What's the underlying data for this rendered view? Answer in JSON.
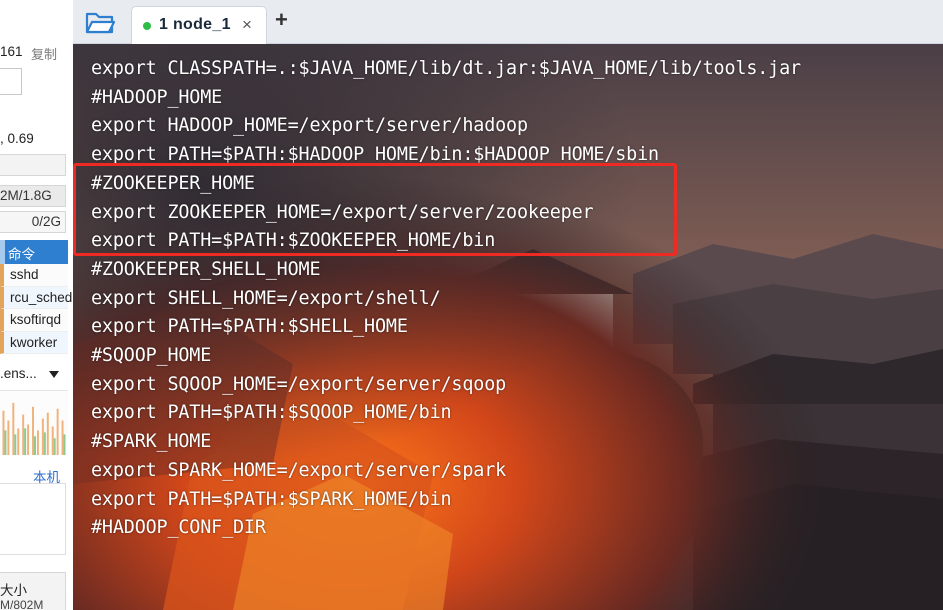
{
  "colors": {
    "tab_active_dot": "#2fbd47",
    "highlight": "#ee2a22",
    "accent_blue": "#2f7fd1",
    "terminal_text": "#ffffff"
  },
  "sidebar": {
    "ip_fragment": "161",
    "copy_label": "复制",
    "load_fragment": ", 0.69",
    "memory_fragment": "2M/1.8G",
    "swap_fragment": "0/2G",
    "process_header": "命令",
    "processes": [
      "sshd",
      "rcu_sched",
      "ksoftirqd",
      "kworker"
    ],
    "network_fragment": ".ens...",
    "local_label": "本机",
    "size_label": "大小",
    "size_value_fragment": "M/802M"
  },
  "tabs": [
    {
      "index": "1",
      "label": "node_1",
      "status": "connected",
      "close_symbol": "×"
    }
  ],
  "tab_add_symbol": "+",
  "icons": {
    "folder": "folder-icon",
    "close": "close-icon",
    "add": "plus-icon"
  },
  "terminal": {
    "lines": [
      "export CLASSPATH=.:$JAVA_HOME/lib/dt.jar:$JAVA_HOME/lib/tools.jar",
      "#HADOOP_HOME",
      "export HADOOP_HOME=/export/server/hadoop",
      "export PATH=$PATH:$HADOOP_HOME/bin:$HADOOP_HOME/sbin",
      "#ZOOKEEPER_HOME",
      "export ZOOKEEPER_HOME=/export/server/zookeeper",
      "export PATH=$PATH:$ZOOKEEPER_HOME/bin",
      "#ZOOKEEPER_SHELL_HOME",
      "export SHELL_HOME=/export/shell/",
      "export PATH=$PATH:$SHELL_HOME",
      "#SQOOP_HOME",
      "export SQOOP_HOME=/export/server/sqoop",
      "export PATH=$PATH:$SQOOP_HOME/bin",
      "#SPARK_HOME",
      "export SPARK_HOME=/export/server/spark",
      "export PATH=$PATH:$SPARK_HOME/bin",
      "#HADOOP_CONF_DIR"
    ],
    "highlighted_lines": [
      4,
      5,
      6
    ]
  }
}
